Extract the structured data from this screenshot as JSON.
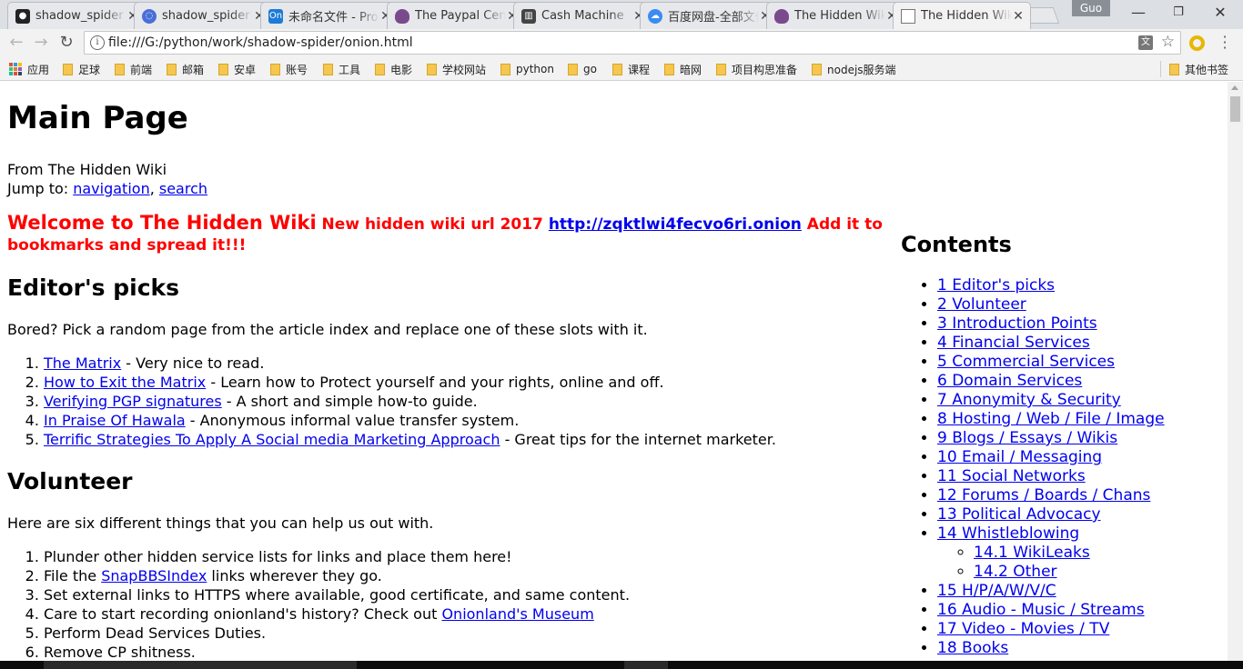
{
  "tabs": [
    {
      "title": "shadow_spider",
      "favicon": "github-icon",
      "color": "#222222"
    },
    {
      "title": "shadow_spider",
      "favicon": "blue-circle-icon",
      "color": "#4a6fd8"
    },
    {
      "title": "未命名文件 - ProcessOn",
      "favicon": "processon-icon",
      "color": "#1e7bd6"
    },
    {
      "title": "The Paypal Cent",
      "favicon": "onion-icon",
      "color": "#7a4a8c"
    },
    {
      "title": "Cash Machine",
      "favicon": "book-icon",
      "color": "#444444"
    },
    {
      "title": "百度网盘-全部文件",
      "favicon": "baidu-cloud-icon",
      "color": "#3a8cf0"
    },
    {
      "title": "The Hidden Wiki",
      "favicon": "onion-icon",
      "color": "#7a4a8c"
    },
    {
      "title": "The Hidden Wiki",
      "favicon": "page-icon",
      "color": "#ffffff",
      "active": true
    }
  ],
  "profile_name": "Guo",
  "address_bar": {
    "url": "file:///G:/python/work/shadow-spider/onion.html"
  },
  "bookmarks": {
    "apps_label": "应用",
    "items": [
      "足球",
      "前端",
      "邮箱",
      "安卓",
      "账号",
      "工具",
      "电影",
      "学校网站",
      "python",
      "go",
      "课程",
      "暗网",
      "项目构思准备",
      "nodejs服务端"
    ],
    "other_label": "其他书签"
  },
  "page": {
    "title": "Main Page",
    "subtitle": "From The Hidden Wiki",
    "jump_prefix": "Jump to: ",
    "jump_navigation": "navigation",
    "jump_sep": ", ",
    "jump_search": "search",
    "welcome_big": "Welcome to The Hidden Wiki",
    "welcome_small": " New hidden wiki url 2017 ",
    "welcome_link": "http://zqktlwi4fecvo6ri.onion",
    "welcome_tail": " Add it to bookmarks and spread it!!!",
    "editors_heading": "Editor's picks",
    "editors_intro": "Bored? Pick a random page from the article index and replace one of these slots with it.",
    "editors_picks": [
      {
        "link": "The Matrix",
        "text": " - Very nice to read."
      },
      {
        "link": "How to Exit the Matrix",
        "text": " - Learn how to Protect yourself and your rights, online and off."
      },
      {
        "link": "Verifying PGP signatures",
        "text": " - A short and simple how-to guide."
      },
      {
        "link": "In Praise Of Hawala",
        "text": " - Anonymous informal value transfer system."
      },
      {
        "link": "Terrific Strategies To Apply A Social media Marketing Approach",
        "text": " - Great tips for the internet marketer."
      }
    ],
    "volunteer_heading": "Volunteer",
    "volunteer_intro": "Here are six different things that you can help us out with.",
    "volunteer_items": {
      "v1": "Plunder other hidden service lists for links and place them here!",
      "v2_pre": "File the ",
      "v2_link": "SnapBBSIndex",
      "v2_post": " links wherever they go.",
      "v3": "Set external links to HTTPS where available, good certificate, and same content.",
      "v4_pre": "Care to start recording onionland's history? Check out ",
      "v4_link": "Onionland's Museum",
      "v5": "Perform Dead Services Duties.",
      "v6": "Remove CP shitness."
    }
  },
  "contents": {
    "title": "Contents",
    "items": [
      "1 Editor's picks",
      "2 Volunteer",
      "3 Introduction Points",
      "4 Financial Services",
      "5 Commercial Services",
      "6 Domain Services",
      "7 Anonymity & Security",
      "8 Hosting / Web / File / Image",
      "9 Blogs / Essays / Wikis",
      "10 Email / Messaging",
      "11 Social Networks",
      "12 Forums / Boards / Chans",
      "13 Political Advocacy",
      "14 Whistleblowing"
    ],
    "sub_items": [
      "14.1 WikiLeaks",
      "14.2 Other"
    ],
    "items_after": [
      "15 H/P/A/W/V/C",
      "16 Audio - Music / Streams",
      "17 Video - Movies / TV",
      "18 Books"
    ]
  },
  "colors": {
    "link": "#0000ee",
    "welcome_red": "#ff0000"
  }
}
